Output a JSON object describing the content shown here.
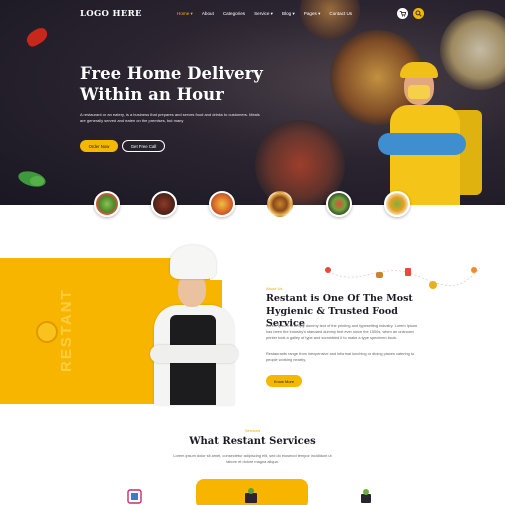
{
  "header": {
    "logo": "LOGO HERE",
    "nav": [
      "Home ▾",
      "About",
      "Categories",
      "Service ▾",
      "Blog ▾",
      "Pages ▾",
      "Contact Us"
    ],
    "icons": [
      "cart-icon",
      "search-icon"
    ]
  },
  "hero": {
    "title_line1": "Free Home Delivery",
    "title_line2": "Within an Hour",
    "description": "A restaurant or an eatery, is a business that prepares and serves food and drinks to customers. Meals are generally served and eaten on the premises, but many",
    "order_button": "Order Now",
    "call_button": "Get Free Call"
  },
  "food_items": [
    "salad",
    "steak",
    "pizza",
    "burger",
    "veggie-plate",
    "wrap"
  ],
  "about": {
    "tag": "About Us",
    "title": "Restant is One Of The Most Hygienic & Trusted Food Service",
    "paragraph1": "Lorem Ipsum is simply dummy text of the printing and typesetting industry. Lorem Ipsum has been the industry's standard dummy text ever since the 1500s, when an unknown printer took a galley of type and scrambled it to make a type specimen book.",
    "paragraph2": "Restaurants range from inexpensive and informal lunching or dining places catering to people working nearby,",
    "button": "Know More",
    "vertical_text": "RESTANT"
  },
  "services": {
    "tag": "Services",
    "title": "What Restant Services",
    "description": "Lorem ipsum dolor sit amet, consectetur adipiscing elit, sed do eiusmod tempor incididunt ut labore et dolore magna aliqua."
  },
  "colors": {
    "accent": "#f5b800",
    "hero_bg": "#2a2430",
    "heading": "#1c1a22"
  }
}
